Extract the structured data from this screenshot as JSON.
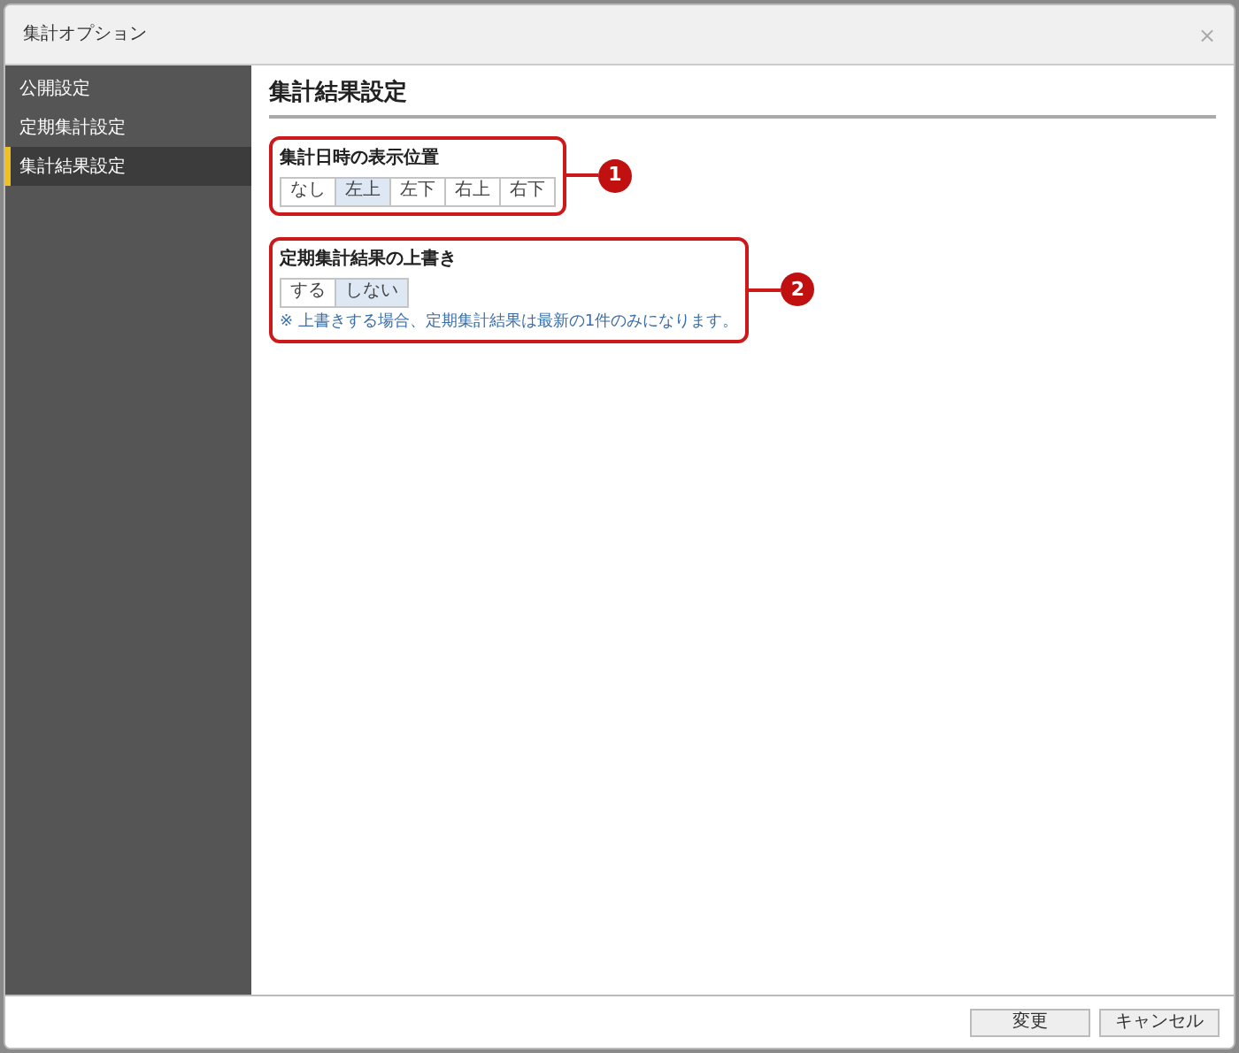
{
  "window": {
    "title": "集計オプション",
    "close": "×"
  },
  "sidebar": {
    "items": [
      {
        "label": "公開設定",
        "selected": false
      },
      {
        "label": "定期集計設定",
        "selected": false
      },
      {
        "label": "集計結果設定",
        "selected": true
      }
    ]
  },
  "content": {
    "heading": "集計結果設定",
    "sections": [
      {
        "label": "集計日時の表示位置",
        "marker": "1",
        "options": [
          {
            "label": "なし",
            "selected": false
          },
          {
            "label": "左上",
            "selected": true
          },
          {
            "label": "左下",
            "selected": false
          },
          {
            "label": "右上",
            "selected": false
          },
          {
            "label": "右下",
            "selected": false
          }
        ]
      },
      {
        "label": "定期集計結果の上書き",
        "marker": "2",
        "options": [
          {
            "label": "する",
            "selected": false
          },
          {
            "label": "しない",
            "selected": true
          }
        ],
        "note": "※ 上書きする場合、定期集計結果は最新の1件のみになります。"
      }
    ]
  },
  "footer": {
    "buttons": [
      "変更",
      "キャンセル"
    ]
  }
}
